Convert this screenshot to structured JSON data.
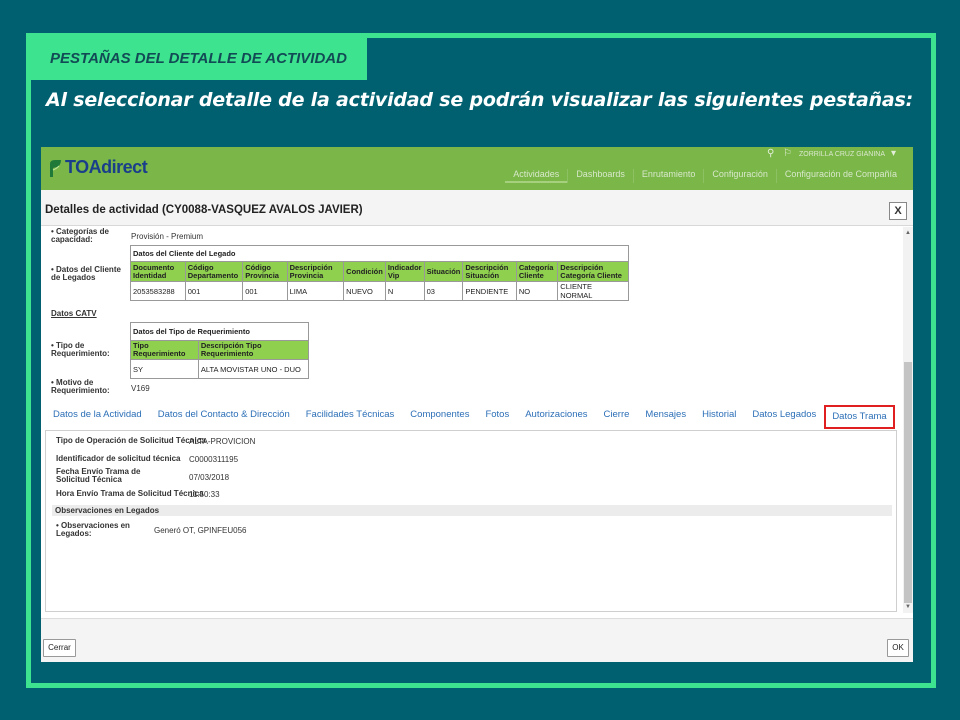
{
  "slide": {
    "tab_label": "PESTAÑAS DEL DETALLE DE ACTIVIDAD",
    "lead": "Al seleccionar detalle de la actividad se podrán visualizar las siguientes pestañas:",
    "accent_color": "#3de38f",
    "bg_color": "#006070"
  },
  "app": {
    "logo": "TOAdirect",
    "user": "ZORRILLA CRUZ GIANINA",
    "menu": [
      "Actividades",
      "Dashboards",
      "Enrutamiento",
      "Configuración",
      "Configuración de Compañía"
    ],
    "icons": [
      "search-icon",
      "bell-icon",
      "user-icon"
    ],
    "brand_color": "#7ab648"
  },
  "dialog": {
    "title": "Detalles de actividad (CY0088-VASQUEZ AVALOS JAVIER)",
    "close": "X",
    "fields": {
      "categorias_label": "• Categorías de capacidad:",
      "categorias_value": "Provisión - Premium",
      "cliente_legados_label": "• Datos del Cliente de Legados",
      "datos_catv": "Datos CATV",
      "tipo_req_label": "• Tipo de Requerimiento:",
      "motivo_label": "• Motivo de Requerimiento:",
      "motivo_value": "V169"
    },
    "cliente_table": {
      "caption": "Datos del Cliente del Legado",
      "headers": [
        "Documento Identidad",
        "Código Departamento",
        "Código Provincia",
        "Descripción Provincia",
        "Condición",
        "Indicador Vip",
        "Situación",
        "Descripción Situación",
        "Categoría Cliente",
        "Descripción Categoría Cliente"
      ],
      "row": [
        "2053583288",
        "001",
        "001",
        "LIMA",
        "NUEVO",
        "N",
        "03",
        "PENDIENTE",
        "NO",
        "CLIENTE NORMAL"
      ]
    },
    "req_table": {
      "caption": "Datos del Tipo de Requerimiento",
      "headers": [
        "Tipo Requerimiento",
        "Descripción Tipo Requerimiento"
      ],
      "row": [
        "SY",
        "ALTA MOVISTAR UNO - DUO"
      ]
    },
    "tabs": [
      "Datos de la Actividad",
      "Datos del Contacto & Dirección",
      "Facilidades Técnicas",
      "Componentes",
      "Fotos",
      "Autorizaciones",
      "Cierre",
      "Mensajes",
      "Historial",
      "Datos Legados",
      "Datos Trama"
    ],
    "active_tab": "Datos Trama",
    "trama": {
      "tipo_op_label": "Tipo de Operación de Solicitud Técnica",
      "tipo_op_value": "ALTA-PROVICION",
      "ident_label": "Identificador de solicitud técnica",
      "ident_value": "C0000311195",
      "fecha_label": "Fecha Envío Trama de Solicitud Técnica",
      "fecha_value": "07/03/2018",
      "hora_label": "Hora Envío Trama de Solicitud Técnica",
      "hora_value": "11:50:33",
      "obs_section": "Observaciones en Legados",
      "obs_label": "• Observaciones en Legados:",
      "obs_value": "Generó OT, GPINFEU056"
    },
    "footer": {
      "cancel": "Cerrar",
      "ok": "OK"
    }
  }
}
